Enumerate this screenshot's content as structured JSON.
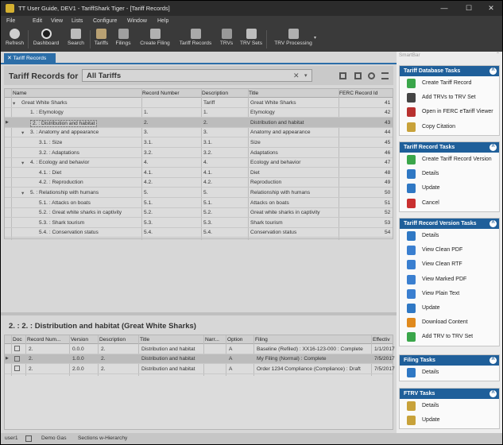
{
  "window": {
    "title": "TT User Guide, DEV1 - TariffShark Tiger - [Tariff Records]",
    "min": "—",
    "max": "☐",
    "close": "✕"
  },
  "menu": [
    "File",
    "Edit",
    "View",
    "Lists",
    "Configure",
    "Window",
    "Help"
  ],
  "toolbar": [
    {
      "label": "Refresh",
      "icon": "refresh-icon",
      "color": "#d0d0d0"
    },
    {
      "label": "Dashboard",
      "icon": "dashboard-icon",
      "color": "#e0e0e0"
    },
    {
      "label": "Search",
      "icon": "binoculars-icon",
      "color": "#cfcfcf"
    },
    {
      "label": "Tariffs",
      "icon": "tariffs-icon",
      "color": "#b9a173"
    },
    {
      "label": "Filings",
      "icon": "filings-icon",
      "color": "#a9a9a9"
    },
    {
      "label": "Create Filing",
      "icon": "create-filing-icon",
      "color": "#b8b8b8"
    },
    {
      "label": "Tariff Records",
      "icon": "tariff-records-icon",
      "color": "#b0b0b0"
    },
    {
      "label": "TRVs",
      "icon": "trvs-icon",
      "color": "#a0a0a0"
    },
    {
      "label": "TRV Sets",
      "icon": "trv-sets-icon",
      "color": "#c0c0c0"
    },
    {
      "label": "TRV Processing",
      "icon": "trv-processing-icon",
      "color": "#b5b5b5"
    }
  ],
  "doc_tab": "Tariff Records",
  "records_header": {
    "label": "Tariff Records for",
    "selected": "All Tariffs",
    "clear": "✕",
    "dropdown": "▾"
  },
  "grid": {
    "columns": [
      "Name",
      "Record Number",
      "Description",
      "Title",
      "FERC Record Id"
    ],
    "rows": [
      {
        "name": "Great White Sharks",
        "num": "",
        "desc": "Tariff",
        "title": "Great White Sharks",
        "id": "41",
        "lvl": 0,
        "exp": "▾"
      },
      {
        "name": "1. : Etymology",
        "num": "1.",
        "desc": "1.",
        "title": "Etymology",
        "id": "42",
        "lvl": 1,
        "exp": ""
      },
      {
        "name": "2. : Distribution and habitat",
        "num": "2.",
        "desc": "2.",
        "title": "Distribution and habitat",
        "id": "43",
        "lvl": 1,
        "exp": "",
        "sel": true
      },
      {
        "name": "3. : Anatomy and appearance",
        "num": "3.",
        "desc": "3.",
        "title": "Anatomy and appearance",
        "id": "44",
        "lvl": 1,
        "exp": "▾"
      },
      {
        "name": "3.1. : Size",
        "num": "3.1.",
        "desc": "3.1.",
        "title": "Size",
        "id": "45",
        "lvl": 2,
        "exp": ""
      },
      {
        "name": "3.2. : Adaptations",
        "num": "3.2.",
        "desc": "3.2.",
        "title": "Adaptations",
        "id": "46",
        "lvl": 2,
        "exp": ""
      },
      {
        "name": "4. : Ecology and behavior",
        "num": "4.",
        "desc": "4.",
        "title": "Ecology and behavior",
        "id": "47",
        "lvl": 1,
        "exp": "▾"
      },
      {
        "name": "4.1. : Diet",
        "num": "4.1.",
        "desc": "4.1.",
        "title": "Diet",
        "id": "48",
        "lvl": 2,
        "exp": ""
      },
      {
        "name": "4.2. : Reproduction",
        "num": "4.2.",
        "desc": "4.2.",
        "title": "Reproduction",
        "id": "49",
        "lvl": 2,
        "exp": ""
      },
      {
        "name": "5. : Relationship with humans",
        "num": "5.",
        "desc": "5.",
        "title": "Relationship with humans",
        "id": "50",
        "lvl": 1,
        "exp": "▾"
      },
      {
        "name": "5.1. : Attacks on boats",
        "num": "5.1.",
        "desc": "5.1.",
        "title": "Attacks on boats",
        "id": "51",
        "lvl": 2,
        "exp": ""
      },
      {
        "name": "5.2. : Great white sharks in captivity",
        "num": "5.2.",
        "desc": "5.2.",
        "title": "Great white sharks in captivity",
        "id": "52",
        "lvl": 2,
        "exp": ""
      },
      {
        "name": "5.3. : Shark tourism",
        "num": "5.3.",
        "desc": "5.3.",
        "title": "Shark tourism",
        "id": "53",
        "lvl": 2,
        "exp": ""
      },
      {
        "name": "5.4. : Conservation status",
        "num": "5.4.",
        "desc": "5.4.",
        "title": "Conservation status",
        "id": "54",
        "lvl": 2,
        "exp": ""
      }
    ]
  },
  "detail": {
    "title": "2. : 2. : Distribution and habitat (Great White Sharks)",
    "columns": [
      "Doc",
      "Record Num...",
      "Version",
      "Description",
      "Title",
      "Narr...",
      "Option",
      "Filing",
      "Effectiv"
    ],
    "rows": [
      {
        "num": "2.",
        "ver": "0.0.0",
        "desc": "2.",
        "title": "Distribution and habitat",
        "opt": "A",
        "filing": "Baseline (Refiled) : XX16-123-000 : Complete",
        "eff": "1/1/2017"
      },
      {
        "num": "2.",
        "ver": "1.0.0",
        "desc": "2.",
        "title": "Distribution and habitat",
        "opt": "A",
        "filing": "My Filing (Normal) : Complete",
        "eff": "7/5/2017",
        "sel": true
      },
      {
        "num": "2.",
        "ver": "2.0.0",
        "desc": "2.",
        "title": "Distribution and habitat",
        "opt": "A",
        "filing": "Order 1234 Compliance (Compliance) : Draft",
        "eff": "7/5/2017"
      }
    ]
  },
  "status": [
    "user1",
    "Demo Gas",
    "Sections w-Hierarchy"
  ],
  "smartbar": {
    "title": "SmartBar",
    "pin": "⌃",
    "panels": [
      {
        "title": "Tariff Database Tasks",
        "items": [
          {
            "label": "Create Tariff Record",
            "icon": "create-record-icon",
            "color": "#3aa64a"
          },
          {
            "label": "Add TRVs to TRV Set",
            "icon": "add-trvs-icon",
            "color": "#444444"
          },
          {
            "label": "Open in FERC eTariff Viewer",
            "icon": "etariff-viewer-icon",
            "color": "#b8312f"
          },
          {
            "label": "Copy Citation",
            "icon": "copy-citation-icon",
            "color": "#c8a23a"
          }
        ]
      },
      {
        "title": "Tariff Record Tasks",
        "items": [
          {
            "label": "Create Tariff Record Version",
            "icon": "create-version-icon",
            "color": "#3aa64a"
          },
          {
            "label": "Details",
            "icon": "details-icon",
            "color": "#2f78c4"
          },
          {
            "label": "Update",
            "icon": "update-icon",
            "color": "#2f78c4"
          },
          {
            "label": "Cancel",
            "icon": "cancel-icon",
            "color": "#c92f2f"
          }
        ]
      },
      {
        "title": "Tariff Record Version Tasks",
        "items": [
          {
            "label": "Details",
            "icon": "details-icon",
            "color": "#2f78c4"
          },
          {
            "label": "View Clean PDF",
            "icon": "pdf-icon",
            "color": "#3a7fd0"
          },
          {
            "label": "View Clean RTF",
            "icon": "rtf-icon",
            "color": "#3a7fd0"
          },
          {
            "label": "View Marked PDF",
            "icon": "marked-pdf-icon",
            "color": "#3a7fd0"
          },
          {
            "label": "View Plain Text",
            "icon": "text-icon",
            "color": "#3a7fd0"
          },
          {
            "label": "Update",
            "icon": "update-icon",
            "color": "#2f78c4"
          },
          {
            "label": "Download Content",
            "icon": "download-icon",
            "color": "#e08a1e"
          },
          {
            "label": "Add TRV to TRV Set",
            "icon": "add-trv-icon",
            "color": "#3aa64a"
          }
        ]
      },
      {
        "title": "Filing Tasks",
        "items": [
          {
            "label": "Details",
            "icon": "details-icon",
            "color": "#2f78c4"
          }
        ]
      },
      {
        "title": "FTRV Tasks",
        "items": [
          {
            "label": "Details",
            "icon": "details-icon",
            "color": "#c8a23a"
          },
          {
            "label": "Update",
            "icon": "update-icon",
            "color": "#c8a23a"
          }
        ]
      }
    ]
  }
}
